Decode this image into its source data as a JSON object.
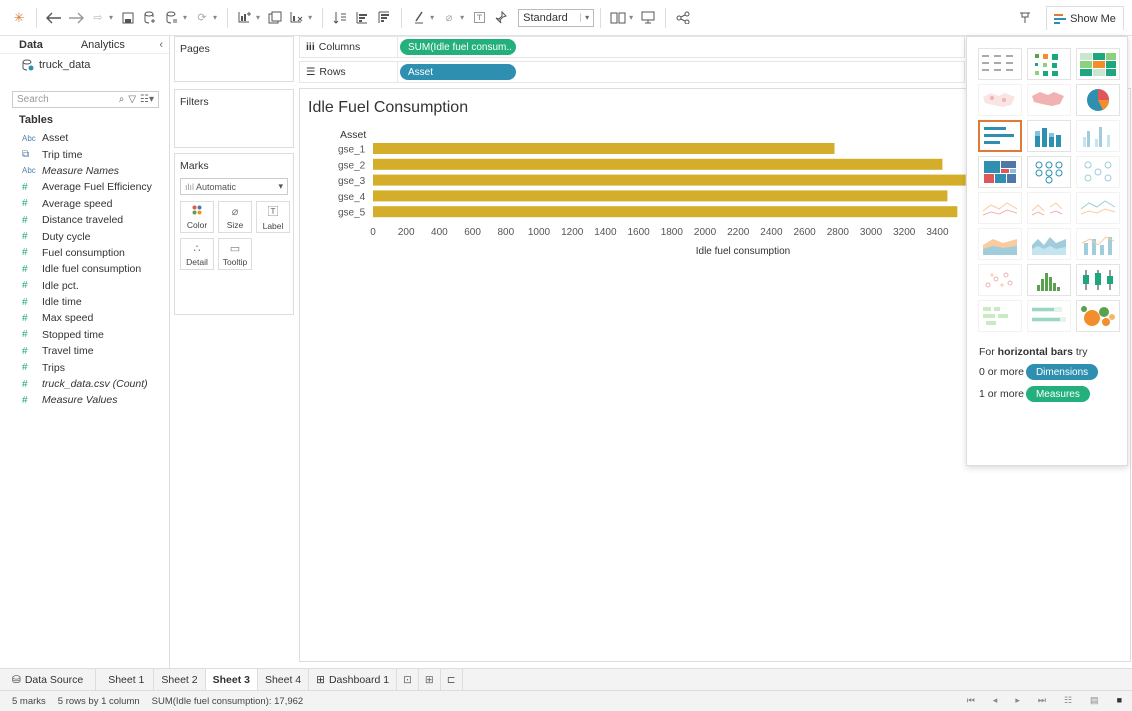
{
  "toolbar": {
    "zoom_value": "Standard",
    "show_me_label": "Show Me"
  },
  "data_pane": {
    "tabs": [
      "Data",
      "Analytics"
    ],
    "source": "truck_data",
    "search_placeholder": "Search",
    "tables_label": "Tables",
    "fields": [
      {
        "type": "Abc",
        "name": "Asset",
        "kind": "dimension",
        "italic": false
      },
      {
        "type": "cal",
        "name": "Trip time",
        "kind": "date",
        "italic": false
      },
      {
        "type": "Abc",
        "name": "Measure Names",
        "kind": "dimension",
        "italic": true
      },
      {
        "type": "#",
        "name": "Average Fuel Efficiency",
        "kind": "measure",
        "italic": false
      },
      {
        "type": "#",
        "name": "Average speed",
        "kind": "measure",
        "italic": false
      },
      {
        "type": "#",
        "name": "Distance traveled",
        "kind": "measure",
        "italic": false
      },
      {
        "type": "#",
        "name": "Duty cycle",
        "kind": "measure",
        "italic": false
      },
      {
        "type": "#",
        "name": "Fuel consumption",
        "kind": "measure",
        "italic": false
      },
      {
        "type": "#",
        "name": "Idle fuel consumption",
        "kind": "measure",
        "italic": false
      },
      {
        "type": "#",
        "name": "Idle pct.",
        "kind": "measure",
        "italic": false
      },
      {
        "type": "#",
        "name": "Idle time",
        "kind": "measure",
        "italic": false
      },
      {
        "type": "#",
        "name": "Max speed",
        "kind": "measure",
        "italic": false
      },
      {
        "type": "#",
        "name": "Stopped time",
        "kind": "measure",
        "italic": false
      },
      {
        "type": "#",
        "name": "Travel time",
        "kind": "measure",
        "italic": false
      },
      {
        "type": "#",
        "name": "Trips",
        "kind": "measure",
        "italic": false
      },
      {
        "type": "#",
        "name": "truck_data.csv (Count)",
        "kind": "measure",
        "italic": true
      },
      {
        "type": "#",
        "name": "Measure Values",
        "kind": "measure",
        "italic": true
      }
    ]
  },
  "cards": {
    "pages": "Pages",
    "filters": "Filters",
    "marks": "Marks",
    "mark_type": "Automatic",
    "mark_buttons": [
      "Color",
      "Size",
      "Label",
      "Detail",
      "Tooltip"
    ]
  },
  "shelves": {
    "columns_label": "Columns",
    "columns_pill": "SUM(Idle fuel consum..",
    "rows_label": "Rows",
    "rows_pill": "Asset"
  },
  "viz": {
    "title": "Idle Fuel Consumption"
  },
  "chart_data": {
    "type": "bar",
    "orientation": "horizontal",
    "title": "Idle Fuel Consumption",
    "category_header": "Asset",
    "categories": [
      "gse_1",
      "gse_2",
      "gse_3",
      "gse_4",
      "gse_5"
    ],
    "values": [
      2780,
      3430,
      3570,
      3460,
      3520
    ],
    "xlabel": "Idle fuel consumption",
    "xticks": [
      0,
      200,
      400,
      600,
      800,
      1000,
      1200,
      1400,
      1600,
      1800,
      2000,
      2200,
      2400,
      2600,
      2800,
      3000,
      3200,
      3400
    ],
    "xlim": [
      0,
      3560
    ],
    "bar_color": "#d4ad2b",
    "grid": false
  },
  "show_me": {
    "hint_prefix": "For ",
    "hint_bold": "horizontal bars",
    "hint_suffix": " try",
    "dim_prefix": "0 or more",
    "dim_pill": "Dimensions",
    "meas_prefix": "1 or more",
    "meas_pill": "Measures",
    "dim_color": "#2e8fb0",
    "meas_color": "#23b07d"
  },
  "sheets": {
    "data_source": "Data Source",
    "tabs": [
      "Sheet 1",
      "Sheet 2",
      "Sheet 3",
      "Sheet 4",
      "Dashboard 1"
    ],
    "active": "Sheet 3"
  },
  "status": {
    "marks": "5 marks",
    "rows": "5 rows by 1 column",
    "sum": "SUM(Idle fuel consumption): 17,962"
  }
}
